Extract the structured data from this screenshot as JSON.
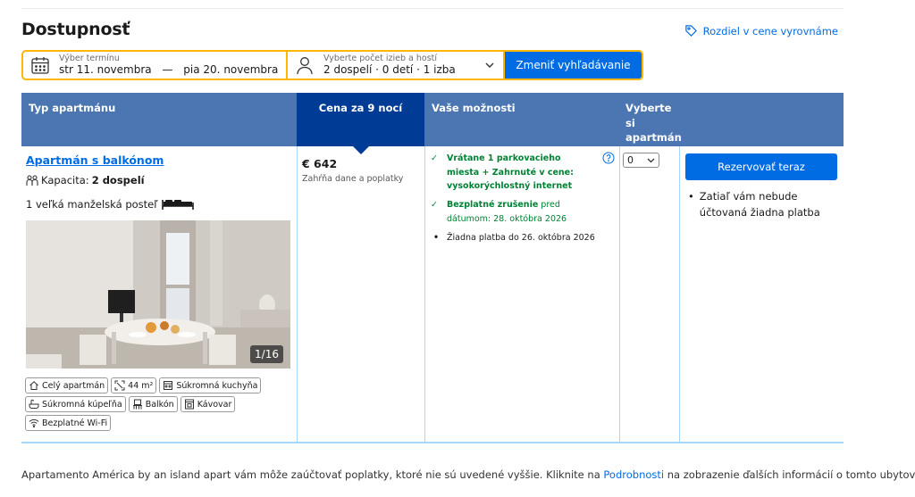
{
  "section": {
    "title": "Dostupnosť",
    "price_match": "Rozdiel v cene vyrovnáme"
  },
  "search": {
    "dates_label": "Výber termínu",
    "dates_start": "str 11. novembra",
    "dates_sep": "—",
    "dates_end": "pia 20. novembra",
    "guests_label": "Vyberte počet izieb a hostí",
    "guests_value": "2 dospelí · 0 detí · 1 izba",
    "change_button": "Zmeniť vyhľadávanie"
  },
  "table": {
    "headers": {
      "room_type": "Typ apartmánu",
      "price": "Cena za 9 nocí",
      "options": "Vaše možnosti",
      "select": "Vyberte si apartmán"
    },
    "room": {
      "name": "Apartmán s balkónom",
      "capacity_label": "Kapacita:",
      "capacity_value": "2 dospelí",
      "bed": "1 veľká manželská posteľ",
      "photo_counter": "1/16",
      "facilities": [
        {
          "label": "Celý apartmán",
          "icon": "house-icon"
        },
        {
          "label": "44 m²",
          "icon": "size-icon"
        },
        {
          "label": "Súkromná kuchyňa",
          "icon": "kitchen-icon"
        },
        {
          "label": "Súkromná kúpeľňa",
          "icon": "bath-icon"
        },
        {
          "label": "Balkón",
          "icon": "balcony-icon"
        },
        {
          "label": "Kávovar",
          "icon": "coffee-icon"
        },
        {
          "label": "Bezplatné Wi-Fi",
          "icon": "wifi-icon"
        }
      ]
    },
    "price": {
      "amount": "€ 642",
      "note": "Zahŕňa dane a poplatky"
    },
    "options": {
      "opt1": "Vrátane 1 parkovacieho miesta + Zahrnuté v cene: vysokorýchlostný internet",
      "opt2_bold": "Bezplatné zrušenie",
      "opt2_rest": " pred dátumom: 28. októbra 2026",
      "opt3": "Žiadna platba do 26. októbra 2026"
    },
    "quantity": "0",
    "reserve_button": "Rezervovať teraz",
    "reserve_note": "Zatiaľ vám nebude účtovaná žiadna platba"
  },
  "footnote": {
    "before": "Apartamento América by an island apart vám môže zaúčtovať poplatky, ktoré nie sú uvedené vyššie. Kliknite na ",
    "link": "Podrobnosti",
    "after": " na zobrazenie ďalších informácií o tomto ubytovaní."
  },
  "colors": {
    "accent": "#006ce4",
    "header": "#4c76b2",
    "header_active": "#003b95",
    "search_border": "#ffb700",
    "positive": "#008234"
  }
}
